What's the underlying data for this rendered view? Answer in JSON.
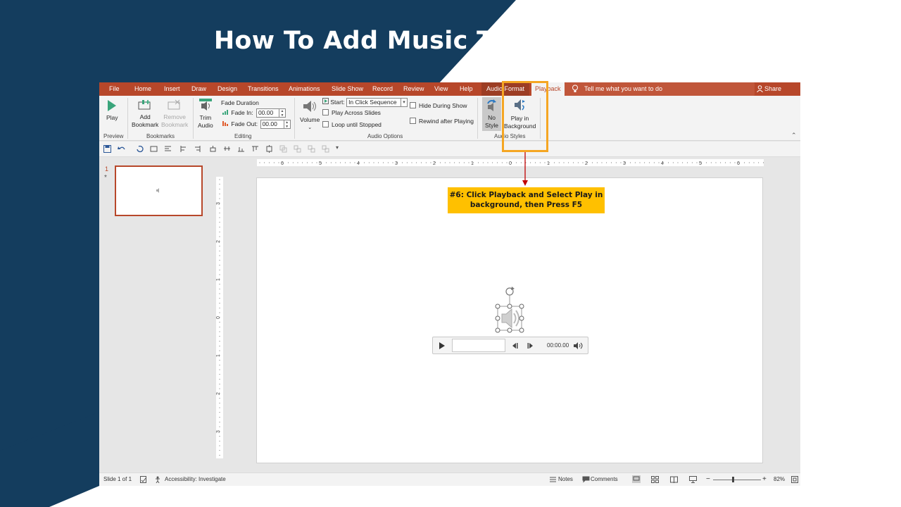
{
  "title": "How To Add Music To A Slideshow",
  "colors": {
    "navy": "#143d5e",
    "accent": "#b7472a",
    "callout": "#ffc000",
    "highlight": "#f5a623"
  },
  "menu": {
    "tabs": [
      "File",
      "Home",
      "Insert",
      "Draw",
      "Design",
      "Transitions",
      "Animations",
      "Slide Show",
      "Record",
      "Review",
      "View",
      "Help"
    ],
    "audio_format": "Audio Format",
    "playback": "Playback",
    "tell_me": "Tell me what you want to do",
    "share": "Share"
  },
  "ribbon": {
    "play": "Play",
    "add_bookmark": [
      "Add",
      "Bookmark"
    ],
    "remove_bookmark": [
      "Remove",
      "Bookmark"
    ],
    "trim_audio": [
      "Trim",
      "Audio"
    ],
    "fade_duration": "Fade Duration",
    "fade_in_label": "Fade In:",
    "fade_in_value": "00.00",
    "fade_out_label": "Fade Out:",
    "fade_out_value": "00.00",
    "volume": "Volume",
    "start_label": "Start:",
    "start_value": "In Click Sequence",
    "play_across_slides": "Play Across Slides",
    "loop_until_stopped": "Loop until Stopped",
    "hide_during_show": "Hide During Show",
    "rewind_after_playing": "Rewind after Playing",
    "no_style": [
      "No",
      "Style"
    ],
    "play_in_background": [
      "Play in",
      "Background"
    ],
    "groups": {
      "preview": "Preview",
      "bookmarks": "Bookmarks",
      "editing": "Editing",
      "audio_options": "Audio Options",
      "audio_styles": "Audio Styles"
    }
  },
  "slides_pane": {
    "slide_number": "1",
    "slide_star": "*"
  },
  "ruler": {
    "h_ticks": [
      "6",
      "5",
      "4",
      "3",
      "2",
      "1",
      "0",
      "1",
      "2",
      "3",
      "4",
      "5",
      "6"
    ],
    "v_ticks": [
      "3",
      "2",
      "1",
      "0",
      "1",
      "2",
      "3"
    ]
  },
  "callout": {
    "line1": "#6: Click Playback and Select Play in",
    "line2": "background, then Press F5"
  },
  "player": {
    "time": "00:00.00"
  },
  "status": {
    "slide": "Slide 1 of 1",
    "accessibility": "Accessibility: Investigate",
    "notes": "Notes",
    "comments": "Comments",
    "zoom": "82%"
  }
}
